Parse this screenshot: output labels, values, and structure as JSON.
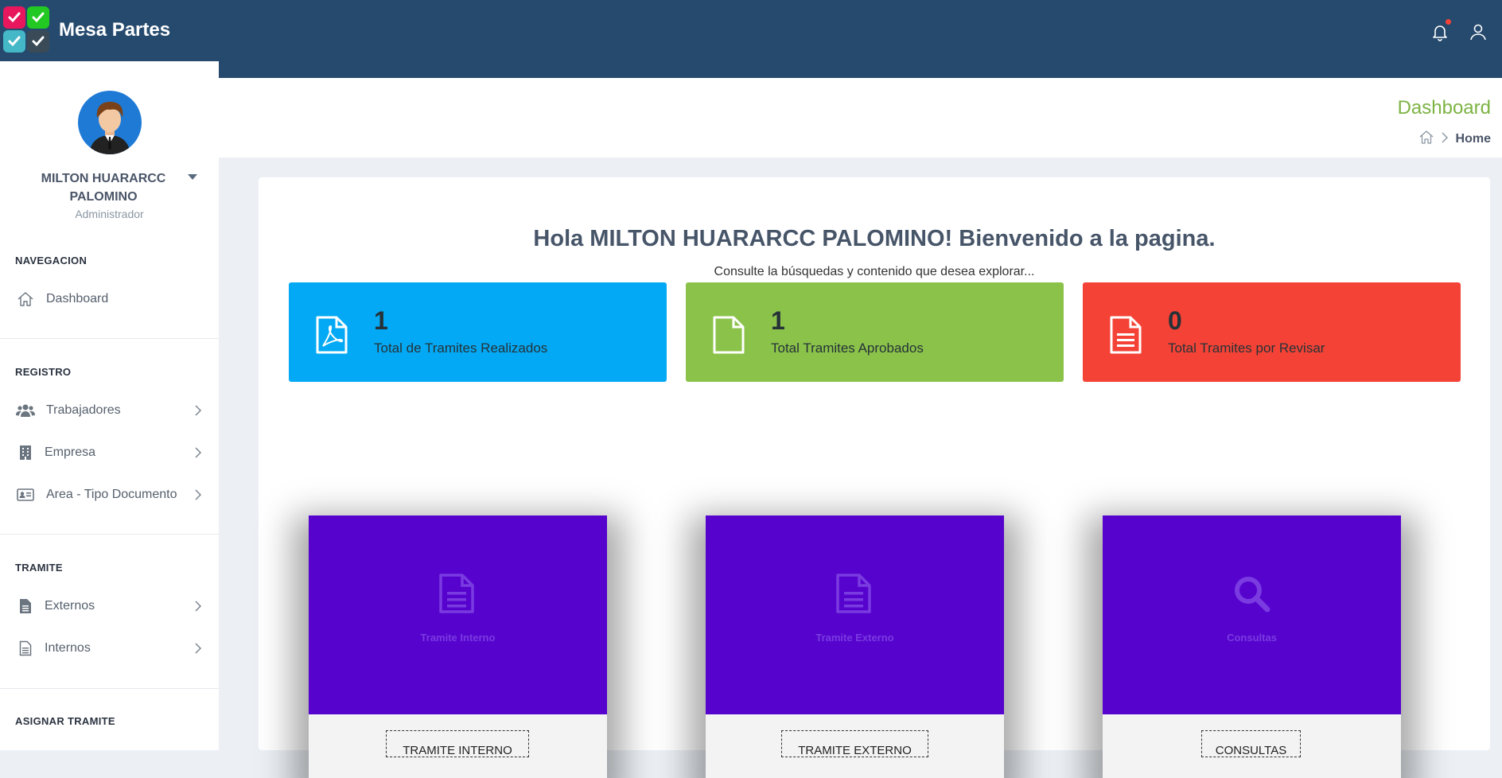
{
  "app": {
    "name": "Mesa Partes"
  },
  "colors": {
    "topbar": "#264a6e",
    "accent_green": "#7cb342",
    "stat_blue": "#03a9f4",
    "stat_green": "#8bc34a",
    "stat_red": "#f44336",
    "tile_purple": "#5603ce"
  },
  "user": {
    "name": "MILTON HUARARCC PALOMINO",
    "role": "Administrador"
  },
  "sidebar": {
    "sections": [
      {
        "title": "NAVEGACION",
        "items": [
          {
            "label": "Dashboard",
            "icon": "home-icon"
          }
        ]
      },
      {
        "title": "REGISTRO",
        "items": [
          {
            "label": "Trabajadores",
            "icon": "users-icon"
          },
          {
            "label": "Empresa",
            "icon": "building-icon"
          },
          {
            "label": "Area - Tipo Documento",
            "icon": "id-card-icon"
          }
        ]
      },
      {
        "title": "TRAMITE",
        "items": [
          {
            "label": "Externos",
            "icon": "file-icon"
          },
          {
            "label": "Internos",
            "icon": "file-outline-icon"
          }
        ]
      },
      {
        "title": "ASIGNAR TRAMITE",
        "items": []
      }
    ]
  },
  "header": {
    "title": "Dashboard",
    "breadcrumb": {
      "home_icon": "home-icon",
      "current": "Home"
    }
  },
  "main": {
    "greeting": "Hola MILTON HUARARCC PALOMINO! Bienvenido a la pagina.",
    "subtitle": "Consulte la búsquedas y contenido que desea explorar...",
    "stats": [
      {
        "value": "1",
        "label": "Total de Tramites Realizados",
        "icon": "pdf-file-icon"
      },
      {
        "value": "1",
        "label": "Total Tramites Aprobados",
        "icon": "file-icon"
      },
      {
        "value": "0",
        "label": "Total Tramites por Revisar",
        "icon": "document-lines-icon"
      }
    ],
    "tiles": [
      {
        "caption": "Tramite Interno",
        "button": "TRAMITE INTERNO",
        "icon": "document-icon"
      },
      {
        "caption": "Tramite Externo",
        "button": "TRAMITE EXTERNO",
        "icon": "document-icon"
      },
      {
        "caption": "Consultas",
        "button": "CONSULTAS",
        "icon": "search-icon"
      }
    ]
  }
}
